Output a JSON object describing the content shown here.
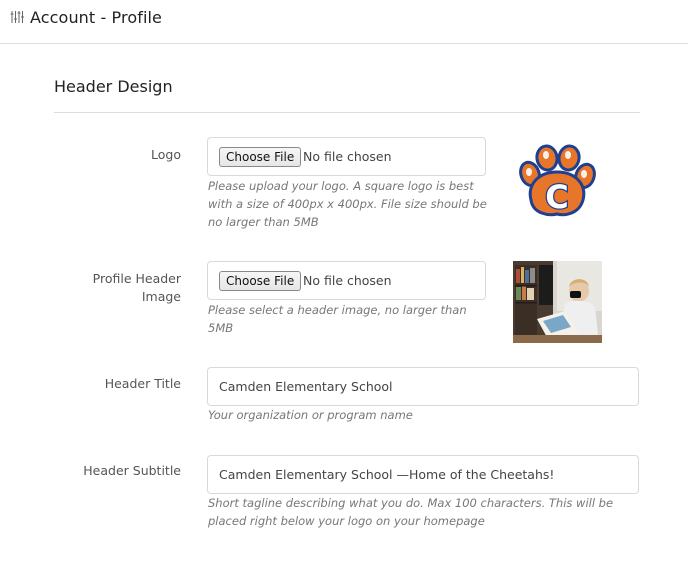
{
  "header": {
    "icon": "sliders-icon",
    "title": "Account - Profile"
  },
  "section": {
    "title": "Header Design"
  },
  "logo": {
    "label": "Logo",
    "button_label": "Choose File",
    "status": "No file chosen",
    "help_lines": [
      "Please upload your logo. A square logo is best",
      "with a size of 400px x 400px. File size should be",
      "no larger than 5MB"
    ],
    "preview_letter": "C",
    "colors": {
      "orange": "#e8762a",
      "navy": "#1f3f8f"
    }
  },
  "profile_header_image": {
    "label_lines": [
      "Profile Header",
      "Image"
    ],
    "button_label": "Choose File",
    "status": "No file chosen",
    "help_lines": [
      "Please select a header image, no larger than",
      "5MB"
    ]
  },
  "header_title": {
    "label": "Header Title",
    "value": "Camden Elementary School",
    "help": "Your organization or program name"
  },
  "header_subtitle": {
    "label": "Header Subtitle",
    "value": "Camden Elementary School —Home of the Cheetahs!",
    "help_lines": [
      "Short tagline describing what you do. Max 100 characters. This will be",
      "placed right below your logo on your homepage"
    ]
  }
}
